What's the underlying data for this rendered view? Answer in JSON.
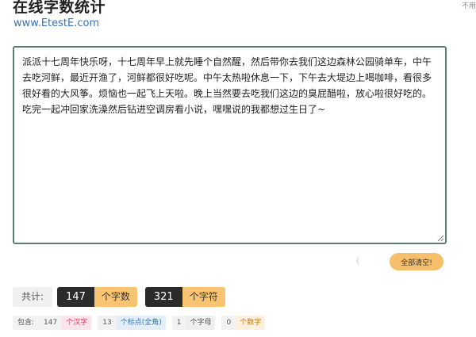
{
  "header": {
    "title": "在线字数统计",
    "site_url": "www.EtestE.com",
    "corner_note": "不用"
  },
  "editor": {
    "text": "派派十七周年快乐呀，十七周年早上就先睡个自然醒，然后带你去我们这边森林公园骑单车，中午去吃河鲜，最近开渔了，河鲜都很好吃呢。中午太热啦休息一下，下午去大堤边上喝咖啡，看很多很好看的大风筝。烦恼也一起飞上天啦。晚上当然要去吃我们这边的臭屁醋啦，放心啦很好吃的。吃完一起冲回家洗澡然后钻进空调房看小说，嘿嘿说的我都想过生日了~"
  },
  "actions": {
    "clear_label": "全部清空!",
    "theme_icon": "moon-icon"
  },
  "totals": {
    "label": "共计:",
    "chars_value": "147",
    "chars_unit": "个字数",
    "symbols_value": "321",
    "symbols_unit": "个字符"
  },
  "breakdown": {
    "label": "包含:",
    "items": [
      {
        "value": "147",
        "unit": "个汉字"
      },
      {
        "value": "13",
        "unit": "个标点(全角)"
      },
      {
        "value": "1",
        "unit": "个字母"
      },
      {
        "value": "0",
        "unit": "个数字"
      }
    ]
  },
  "colors": {
    "accent": "#f8c471",
    "border": "#5b7d73",
    "link": "#3a73b8"
  }
}
